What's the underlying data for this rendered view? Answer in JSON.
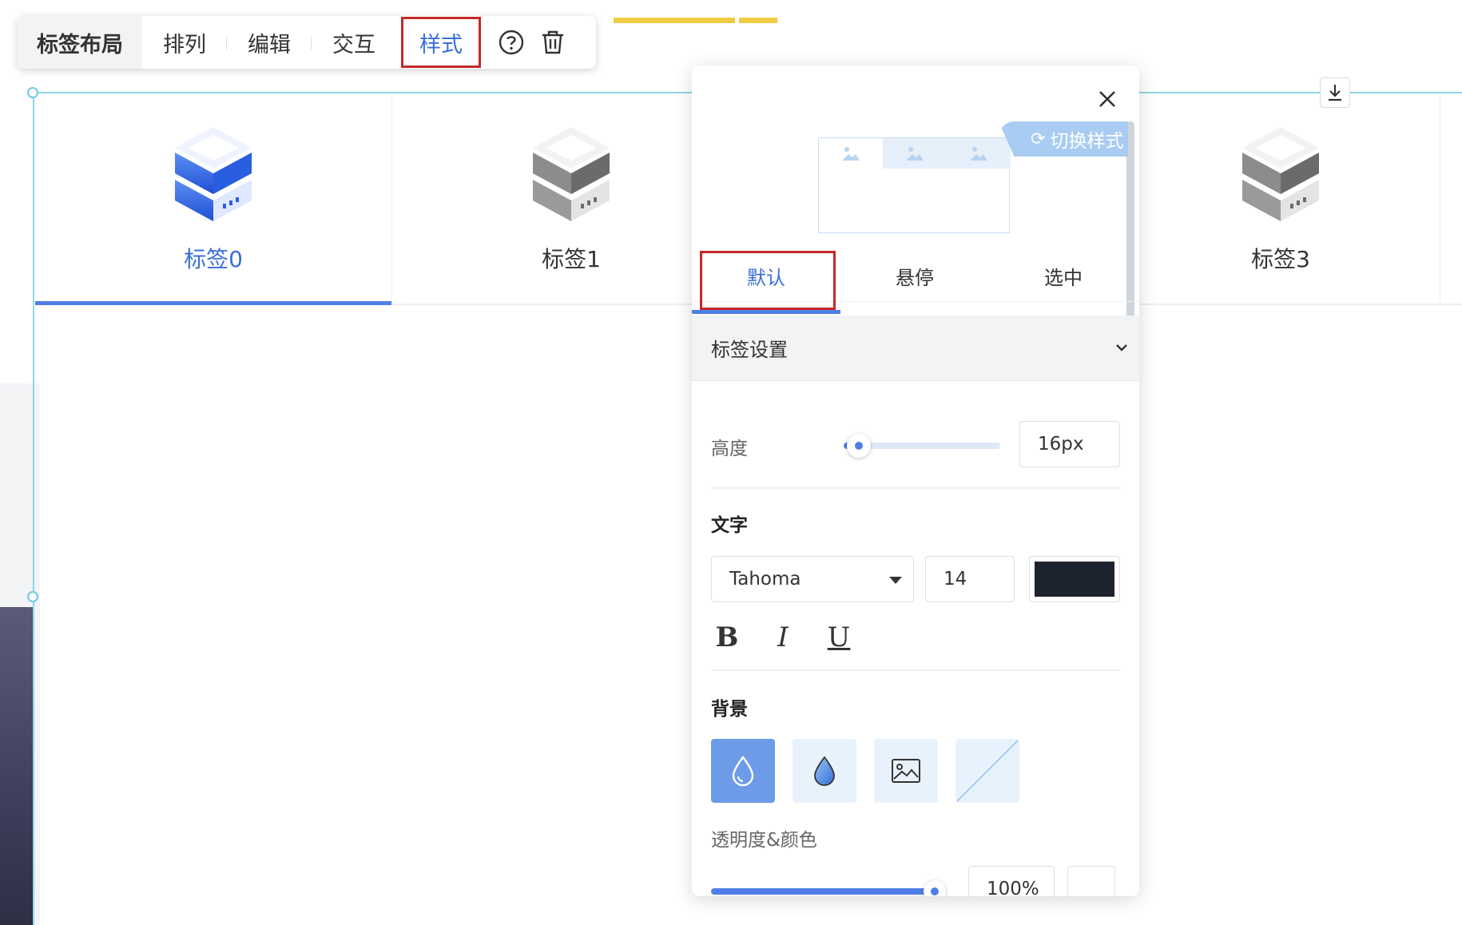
{
  "toolbar": {
    "title": "标签布局",
    "items": [
      "排列",
      "编辑",
      "交互"
    ],
    "active_item": "样式"
  },
  "tabs": [
    {
      "label": "标签0",
      "active": true
    },
    {
      "label": "标签1",
      "active": false
    },
    {
      "label": "标签3",
      "active": false
    }
  ],
  "panel": {
    "switch_style_label": "切换样式",
    "state_tabs": [
      "默认",
      "悬停",
      "选中"
    ],
    "active_state": "默认",
    "section_title": "标签设置",
    "height": {
      "label": "高度",
      "value": "16px"
    },
    "text": {
      "group_title": "文字",
      "font_family": "Tahoma",
      "font_size": "14",
      "color": "#1e2330",
      "bold_label": "B",
      "italic_label": "I",
      "underline_label": "U"
    },
    "background": {
      "group_title": "背景",
      "options": [
        "color-fill-icon",
        "gradient-fill-icon",
        "image-fill-icon",
        "no-fill-icon"
      ],
      "active_option": "color-fill-icon"
    },
    "opacity": {
      "label": "透明度&颜色",
      "value": "100%"
    }
  },
  "colors": {
    "accent": "#4f7ee6",
    "highlight_box": "#c62828"
  }
}
